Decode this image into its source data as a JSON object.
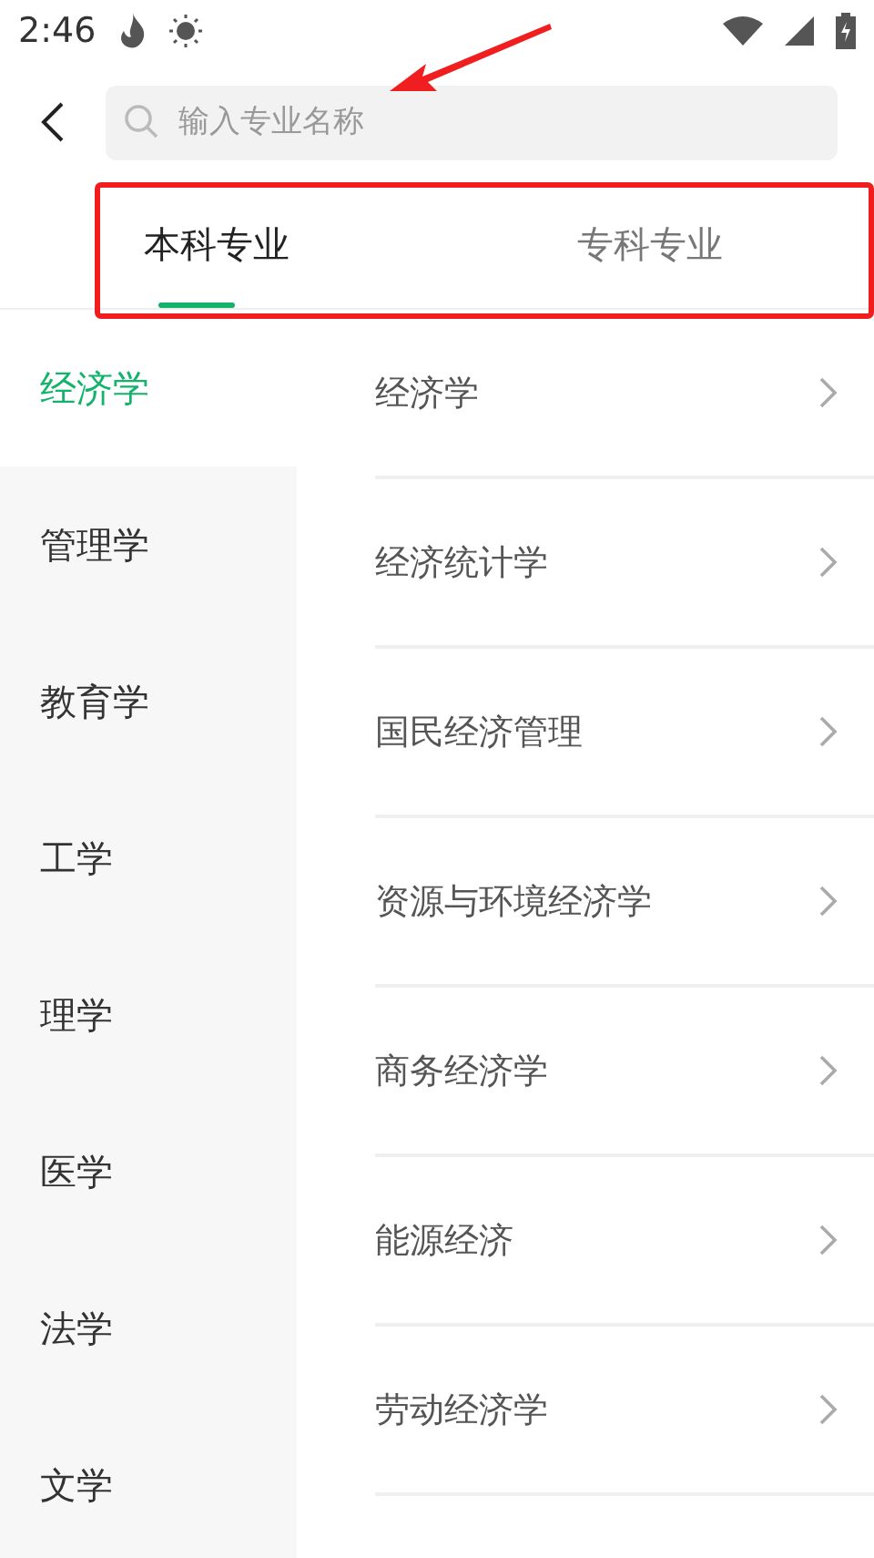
{
  "status_bar": {
    "time": "2:46"
  },
  "search": {
    "placeholder": "输入专业名称"
  },
  "tabs": [
    {
      "label": "本科专业",
      "selected": true
    },
    {
      "label": "专科专业",
      "selected": false
    }
  ],
  "categories": [
    {
      "label": "经济学",
      "selected": true
    },
    {
      "label": "管理学",
      "selected": false
    },
    {
      "label": "教育学",
      "selected": false
    },
    {
      "label": "工学",
      "selected": false
    },
    {
      "label": "理学",
      "selected": false
    },
    {
      "label": "医学",
      "selected": false
    },
    {
      "label": "法学",
      "selected": false
    },
    {
      "label": "文学",
      "selected": false
    }
  ],
  "majors": [
    {
      "label": "经济学"
    },
    {
      "label": "经济统计学"
    },
    {
      "label": "国民经济管理"
    },
    {
      "label": "资源与环境经济学"
    },
    {
      "label": "商务经济学"
    },
    {
      "label": "能源经济"
    },
    {
      "label": "劳动经济学"
    }
  ]
}
